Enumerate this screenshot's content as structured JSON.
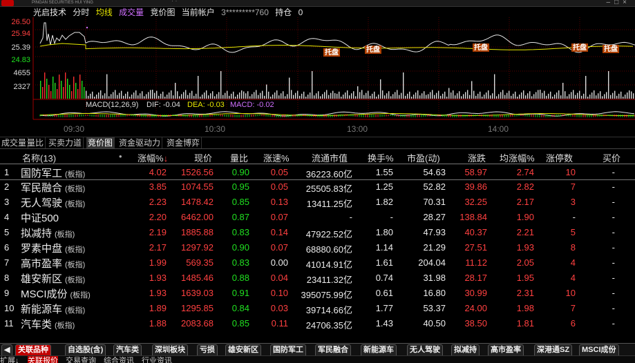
{
  "topbar": {
    "logo_text": "PINGAN SECURITIES",
    "brand_sub": "HUI YING",
    "center_text": "·       ·"
  },
  "info": {
    "stock": "光启技术",
    "mode": "分时",
    "avg_line": "均线",
    "volume": "成交量",
    "bid_chart": "竞价图",
    "account": "当前帐户",
    "account_no": "3*********760",
    "position_label": "持仓",
    "position_val": "0"
  },
  "chart": {
    "price_ticks": [
      "26.50",
      "25.94",
      "25.39",
      "24.83"
    ],
    "volume_ticks": [
      "4655",
      "2327"
    ],
    "macd_label": "MACD(12,26,9)",
    "dif": "DIF: -0.04",
    "dea": "DEA: -0.03",
    "macd": "MACD: -0.02",
    "time_ticks": [
      "09:30",
      "10:30",
      "13:00",
      "14:00"
    ],
    "markers": [
      "托盘",
      "托盘",
      "托盘",
      "托盘",
      "托盘"
    ]
  },
  "tabs": [
    "成交量",
    "量比",
    "买卖力道",
    "竞价图",
    "资金驱动力",
    "资金博弈"
  ],
  "table": {
    "headers": {
      "name": "名称(13)",
      "dot": "•",
      "pct": "涨幅%",
      "price": "现价",
      "vol_ratio": "量比",
      "speed": "涨速%",
      "mcap": "流通市值",
      "turnover": "换手%",
      "pe": "市盈(动)",
      "change": "涨跌",
      "avg_pct": "均涨幅%",
      "limit_up": "涨停数",
      "bid": "买价"
    },
    "rows": [
      {
        "idx": "1",
        "name": "国防军工",
        "tag": "(板指)",
        "pct": "4.02",
        "price": "1526.56",
        "vr": "0.90",
        "speed": "0.05",
        "mcap": "36223.60亿",
        "turn": "1.55",
        "pe": "54.63",
        "chg": "58.97",
        "avg": "2.74",
        "lu": "10",
        "bid": "-"
      },
      {
        "idx": "2",
        "name": "军民融合",
        "tag": "(板指)",
        "pct": "3.85",
        "price": "1074.55",
        "vr": "0.95",
        "speed": "0.05",
        "mcap": "25505.83亿",
        "turn": "1.25",
        "pe": "52.82",
        "chg": "39.86",
        "avg": "2.82",
        "lu": "7",
        "bid": "-"
      },
      {
        "idx": "3",
        "name": "无人驾驶",
        "tag": "(板指)",
        "pct": "2.23",
        "price": "1478.42",
        "vr": "0.85",
        "speed": "0.13",
        "mcap": "13411.25亿",
        "turn": "1.82",
        "pe": "70.31",
        "chg": "32.25",
        "avg": "2.17",
        "lu": "3",
        "bid": "-"
      },
      {
        "idx": "4",
        "name": "中证500",
        "tag": "",
        "pct": "2.20",
        "price": "6462.00",
        "vr": "0.87",
        "speed": "0.07",
        "mcap": "-",
        "turn": "-",
        "pe": "28.27",
        "chg": "138.84",
        "avg": "1.90",
        "lu": "-",
        "bid": "-"
      },
      {
        "idx": "5",
        "name": "拟减持",
        "tag": "(板指)",
        "pct": "2.19",
        "price": "1885.88",
        "vr": "0.83",
        "speed": "0.14",
        "mcap": "47922.52亿",
        "turn": "1.80",
        "pe": "47.93",
        "chg": "40.37",
        "avg": "2.21",
        "lu": "5",
        "bid": "-"
      },
      {
        "idx": "6",
        "name": "罗素中盘",
        "tag": "(板指)",
        "pct": "2.17",
        "price": "1297.92",
        "vr": "0.90",
        "speed": "0.07",
        "mcap": "68880.60亿",
        "turn": "1.14",
        "pe": "21.29",
        "chg": "27.51",
        "avg": "1.93",
        "lu": "8",
        "bid": "-"
      },
      {
        "idx": "7",
        "name": "高市盈率",
        "tag": "(板指)",
        "pct": "1.99",
        "price": "569.35",
        "vr": "0.83",
        "speed": "0.00",
        "mcap": "41014.91亿",
        "turn": "1.61",
        "pe": "204.04",
        "chg": "11.12",
        "avg": "2.05",
        "lu": "4",
        "bid": "-"
      },
      {
        "idx": "8",
        "name": "雄安新区",
        "tag": "(板指)",
        "pct": "1.93",
        "price": "1485.46",
        "vr": "0.88",
        "speed": "0.04",
        "mcap": "23411.32亿",
        "turn": "0.74",
        "pe": "31.98",
        "chg": "28.17",
        "avg": "1.95",
        "lu": "4",
        "bid": "-"
      },
      {
        "idx": "9",
        "name": "MSCI成份",
        "tag": "(板指)",
        "pct": "1.93",
        "price": "1639.03",
        "vr": "0.91",
        "speed": "0.10",
        "mcap": "395075.99亿",
        "turn": "0.61",
        "pe": "16.80",
        "chg": "30.99",
        "avg": "2.31",
        "lu": "10",
        "bid": "-"
      },
      {
        "idx": "10",
        "name": "新能源车",
        "tag": "(板指)",
        "pct": "1.89",
        "price": "1295.85",
        "vr": "0.84",
        "speed": "0.03",
        "mcap": "39714.66亿",
        "turn": "1.77",
        "pe": "53.37",
        "chg": "24.00",
        "avg": "1.98",
        "lu": "7",
        "bid": "-"
      },
      {
        "idx": "11",
        "name": "汽车类",
        "tag": "(板指)",
        "pct": "1.88",
        "price": "2083.68",
        "vr": "0.85",
        "speed": "0.11",
        "mcap": "24706.35亿",
        "turn": "1.43",
        "pe": "40.50",
        "chg": "38.50",
        "avg": "1.81",
        "lu": "6",
        "bid": "-"
      }
    ]
  },
  "bottom_tabs": [
    "关联品种",
    "自选股(含)",
    "汽车类",
    "深圳板块",
    "亏损",
    "雄安新区",
    "国防军工",
    "军民融合",
    "新能源车",
    "无人驾驶",
    "拟减持",
    "高市盈率",
    "深港通SZ",
    "MSCI成份"
  ],
  "bottom_tabs2": [
    "扩展↓",
    "关联报价",
    "交易查询",
    "综合资讯",
    "行业资讯"
  ],
  "colors": {
    "up": "#ff4040",
    "down": "#20e020",
    "accent": "#e8e800",
    "highlight": "#c00000"
  }
}
